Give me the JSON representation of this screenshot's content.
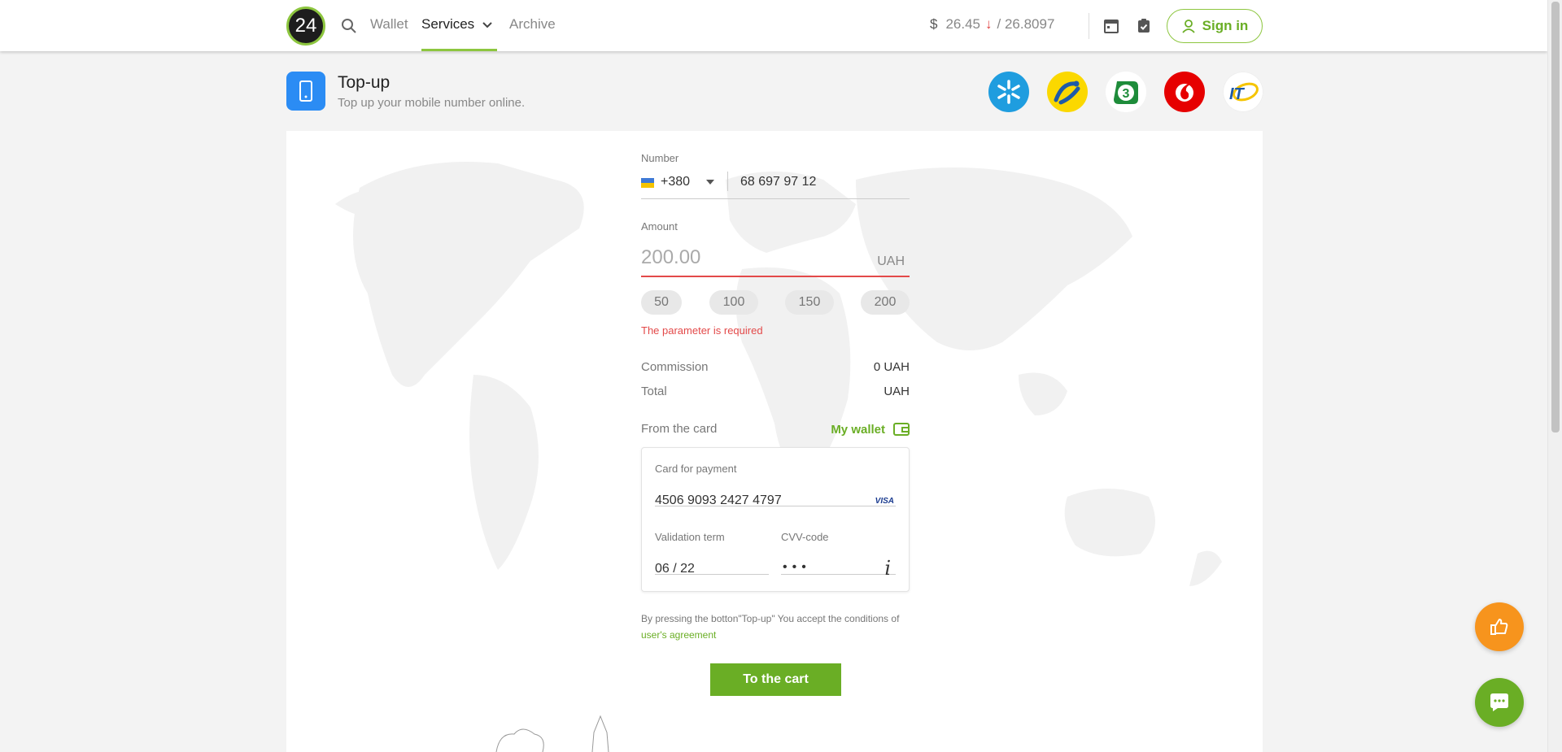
{
  "header": {
    "logo_text": "24",
    "nav": {
      "wallet": "Wallet",
      "services": "Services",
      "archive": "Archive"
    },
    "rate": {
      "currency_symbol": "$",
      "buy": "26.45",
      "arrow": "↓",
      "sell": "/ 26.8097"
    },
    "signin_label": "Sign in"
  },
  "page": {
    "title": "Top-up",
    "subtitle": "Top up your mobile number online.",
    "operators": [
      "kyivstar-icon",
      "lifecell-icon",
      "3mob-icon",
      "vodafone-icon",
      "intertelecom-icon"
    ]
  },
  "form": {
    "number_label": "Number",
    "country_code": "+380",
    "phone_number": "68 697 97 12",
    "amount_label": "Amount",
    "amount_placeholder": "200.00",
    "amount_currency": "UAH",
    "quick_amounts": [
      "50",
      "100",
      "150",
      "200"
    ],
    "error_text": "The parameter is required",
    "commission_label": "Commission",
    "commission_value": "0 UAH",
    "total_label": "Total",
    "total_value": "UAH",
    "from_card_label": "From the card",
    "my_wallet_label": "My wallet",
    "card": {
      "label": "Card for payment",
      "number": "4506 9093 2427 4797",
      "brand": "VISA",
      "validation_label": "Validation term",
      "validation_value": "06 / 22",
      "cvv_label": "CVV-code",
      "cvv_value": "•••",
      "info_glyph": "i"
    },
    "terms_text": "By pressing the botton\"Top-up\" You accept the conditions of ",
    "terms_link": "user's agreement",
    "submit_label": "To the cart"
  },
  "colors": {
    "accent": "#6aae25",
    "error": "#e34949",
    "feedback": "#f7941d"
  }
}
